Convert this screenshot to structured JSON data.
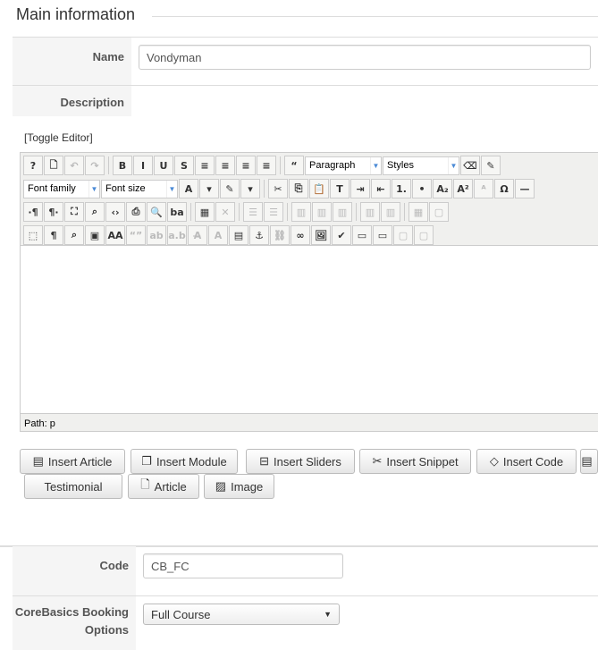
{
  "legend": "Main information",
  "name": {
    "label": "Name",
    "value": "Vondyman"
  },
  "description": {
    "label": "Description"
  },
  "toggle_editor": "[Toggle Editor]",
  "toolbar": {
    "row1": [
      [
        "help-icon",
        "?"
      ],
      [
        "new-document-icon",
        "🗋"
      ],
      [
        "undo-icon",
        "↶",
        "dis"
      ],
      [
        "redo-icon",
        "↷",
        "dis"
      ],
      "|",
      [
        "bold-icon",
        "B"
      ],
      [
        "italic-icon",
        "I"
      ],
      [
        "underline-icon",
        "U"
      ],
      [
        "strikethrough-icon",
        "S"
      ],
      [
        "justify-full-icon",
        "≡"
      ],
      [
        "align-center-icon",
        "≡"
      ],
      [
        "align-left-icon",
        "≡"
      ],
      [
        "align-right-icon",
        "≡"
      ],
      "|",
      [
        "blockquote-icon",
        "“"
      ]
    ],
    "row1_tail": [
      [
        "eraser-icon",
        "⌫"
      ],
      [
        "cleanup-icon",
        "✎"
      ]
    ],
    "paragraph_select": "Paragraph",
    "styles_select": "Styles",
    "font_family_select": "Font family",
    "font_size_select": "Font size",
    "row2": [
      [
        "cut-icon",
        "✂"
      ],
      [
        "copy-icon",
        "⎘"
      ],
      [
        "paste-icon",
        "📋"
      ],
      [
        "paste-text-icon",
        "T"
      ],
      [
        "indent-icon",
        "⇥"
      ],
      [
        "outdent-icon",
        "⇤"
      ],
      [
        "ordered-list-icon",
        "1."
      ],
      [
        "unordered-list-icon",
        "•"
      ],
      [
        "subscript-icon",
        "A₂"
      ],
      [
        "superscript-icon",
        "A²"
      ],
      [
        "style-props-icon",
        "ᴬ",
        "dis"
      ],
      [
        "charmap-icon",
        "Ω"
      ],
      [
        "hr-icon",
        "—"
      ]
    ],
    "row3": [
      [
        "ltr-icon",
        "·¶"
      ],
      [
        "rtl-icon",
        "¶·"
      ],
      [
        "fullscreen-icon",
        "⛶"
      ],
      [
        "preview-icon",
        "⌕"
      ],
      [
        "code-icon",
        "‹›"
      ],
      [
        "print-icon",
        "⎙"
      ],
      [
        "search-icon",
        "🔍"
      ],
      [
        "replace-icon",
        "ba"
      ],
      "|",
      [
        "table-icon",
        "▦"
      ],
      [
        "delete-table-icon",
        "✕",
        "dis"
      ],
      "|",
      [
        "row-before-icon",
        "☰",
        "dis"
      ],
      [
        "row-after-icon",
        "☰",
        "dis"
      ],
      "|",
      [
        "col-before-icon",
        "▥",
        "dis"
      ],
      [
        "col-after-icon",
        "▥",
        "dis"
      ],
      [
        "delete-col-icon",
        "▥",
        "dis"
      ],
      "|",
      [
        "row-props-icon",
        "▥",
        "dis"
      ],
      [
        "col-props-icon",
        "▥",
        "dis"
      ],
      "|",
      [
        "cell-props-icon",
        "▦",
        "dis"
      ],
      [
        "merge-cells-icon",
        "▢",
        "dis"
      ]
    ],
    "row4": [
      [
        "visual-aid-icon",
        "⬚"
      ],
      [
        "pilcrow-icon",
        "¶"
      ],
      [
        "template-icon",
        "⌕"
      ],
      [
        "media-icon",
        "▣"
      ],
      [
        "styles-icon",
        "AA"
      ],
      [
        "cite-icon",
        "“”",
        "dis"
      ],
      [
        "abbr-icon",
        "ab",
        "dis"
      ],
      [
        "acronym-icon",
        "a.b",
        "dis"
      ],
      [
        "del-icon",
        "A̶",
        "dis"
      ],
      [
        "ins-icon",
        "A",
        "dis"
      ],
      [
        "attribs-icon",
        "▤"
      ],
      [
        "anchor-icon",
        "⚓"
      ],
      [
        "unlink-icon",
        "⛓",
        "dis"
      ],
      [
        "link-icon",
        "∞"
      ],
      [
        "image-icon",
        "🖼"
      ],
      [
        "spellcheck-icon",
        "✔"
      ],
      [
        "layer-icon",
        "▭"
      ],
      [
        "absolute-icon",
        "▭"
      ],
      [
        "move-forward-icon",
        "▢",
        "dis"
      ],
      [
        "move-backward-icon",
        "▢",
        "dis"
      ]
    ],
    "path_label": "Path:",
    "path_value": "p"
  },
  "buttons": [
    {
      "icon": "article-icon",
      "glyph": "▤",
      "label": "Insert Article"
    },
    {
      "icon": "module-icon",
      "glyph": "❐",
      "label": "Insert Module"
    },
    {
      "icon": "sliders-icon",
      "glyph": "⊟",
      "label": "Insert Sliders"
    },
    {
      "icon": "scissors-icon",
      "glyph": "✂",
      "label": "Insert Snippet"
    },
    {
      "icon": "code-icon",
      "glyph": "◇",
      "label": "Insert Code"
    },
    {
      "icon": "more-icon",
      "glyph": "▤",
      "label": ""
    },
    {
      "icon": "",
      "glyph": "",
      "label": "Testimonial"
    },
    {
      "icon": "new-article-icon",
      "glyph": "🗋",
      "label": "Article"
    },
    {
      "icon": "image-icon",
      "glyph": "▨",
      "label": "Image"
    }
  ],
  "code": {
    "label": "Code",
    "value": "CB_FC"
  },
  "booking": {
    "label": "CoreBasics Booking Options",
    "value": "Full Course"
  },
  "colors": {
    "border": "#dddddd",
    "label_bg": "#f5f5f5",
    "accent": "#4a8ad6"
  }
}
